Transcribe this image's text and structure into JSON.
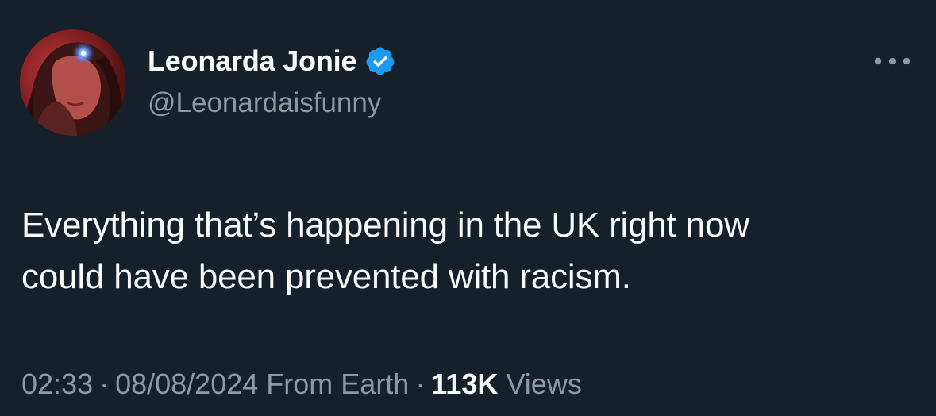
{
  "author": {
    "display_name": "Leonarda Jonie",
    "handle": "@Leonardaisfunny",
    "verified_icon": "verified-badge-icon",
    "verified_color": "#1d9bf0"
  },
  "more_icon": "more-options-icon",
  "tweet": {
    "lines": [
      "Everything that’s happening in the UK right now",
      "could have been prevented with racism."
    ]
  },
  "meta": {
    "time": "02:33",
    "separator": "·",
    "date": "08/08/2024",
    "source": "From Earth",
    "views_count": "113K",
    "views_label": "Views"
  },
  "colors": {
    "background": "#15202b",
    "text_primary": "#f7f9f9",
    "text_secondary": "#8b98a5"
  }
}
